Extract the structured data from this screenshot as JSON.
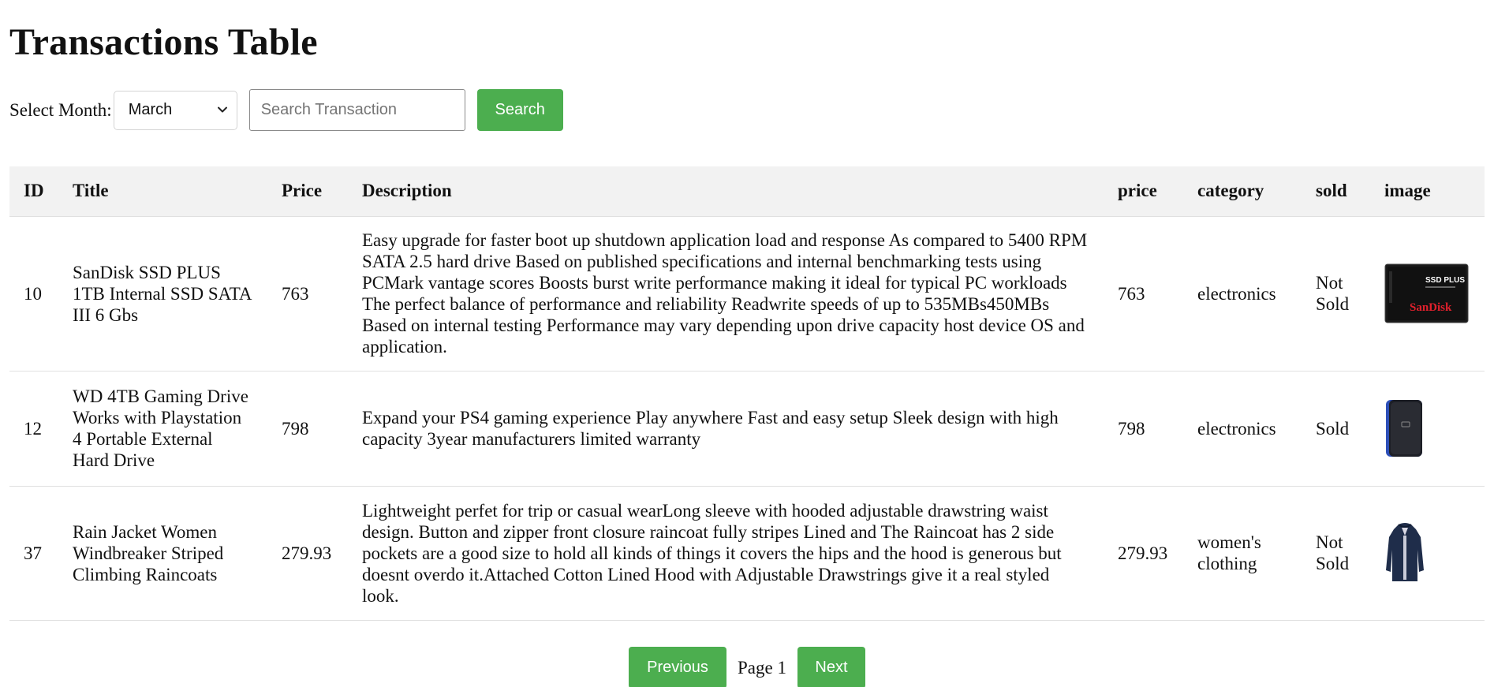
{
  "title": "Transactions Table",
  "controls": {
    "month_label": "Select Month:",
    "selected_month": "March",
    "search_placeholder": "Search Transaction",
    "search_button": "Search"
  },
  "table": {
    "headers": [
      "ID",
      "Title",
      "Price",
      "Description",
      "price",
      "category",
      "sold",
      "image"
    ],
    "rows": [
      {
        "id": "10",
        "title": "SanDisk SSD PLUS 1TB Internal SSD SATA III 6 Gbs",
        "price": "763",
        "description": "Easy upgrade for faster boot up shutdown application load and response As compared to 5400 RPM SATA 2.5 hard drive Based on published specifications and internal benchmarking tests using PCMark vantage scores Boosts burst write performance making it ideal for typical PC workloads The perfect balance of performance and reliability Readwrite speeds of up to 535MBs450MBs Based on internal testing Performance may vary depending upon drive capacity host device OS and application.",
        "price2": "763",
        "category": "electronics",
        "sold": "Not Sold",
        "image_icon": "ssd-product-image",
        "image_text_top": "SSD PLUS",
        "image_text_brand": "SanDisk"
      },
      {
        "id": "12",
        "title": "WD 4TB Gaming Drive Works with Playstation 4 Portable External Hard Drive",
        "price": "798",
        "description": "Expand your PS4 gaming experience Play anywhere Fast and easy setup Sleek design with high capacity 3year manufacturers limited warranty",
        "price2": "798",
        "category": "electronics",
        "sold": "Sold",
        "image_icon": "hard-drive-product-image"
      },
      {
        "id": "37",
        "title": "Rain Jacket Women Windbreaker Striped Climbing Raincoats",
        "price": "279.93",
        "description": "Lightweight perfet for trip or casual wearLong sleeve with hooded adjustable drawstring waist design. Button and zipper front closure raincoat fully stripes Lined and The Raincoat has 2 side pockets are a good size to hold all kinds of things it covers the hips and the hood is generous but doesnt overdo it.Attached Cotton Lined Hood with Adjustable Drawstrings give it a real styled look.",
        "price2": "279.93",
        "category": "women's clothing",
        "sold": "Not Sold",
        "image_icon": "raincoat-product-image"
      }
    ]
  },
  "pagination": {
    "previous_label": "Previous",
    "page_label": "Page 1",
    "next_label": "Next"
  },
  "colors": {
    "button_green": "#4cae4f",
    "header_bg": "#f2f2f2"
  }
}
